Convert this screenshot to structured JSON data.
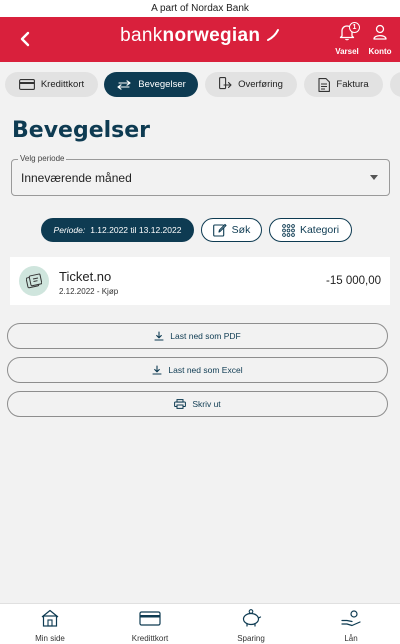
{
  "top_banner": "A part of Nordax Bank",
  "header": {
    "logo_light": "bank",
    "logo_bold": "norwegian",
    "notifications_label": "Varsel",
    "notifications_count": "1",
    "account_label": "Konto"
  },
  "tabs": [
    {
      "label": "Kredittkort",
      "icon": "credit-card-icon"
    },
    {
      "label": "Bevegelser",
      "icon": "transfer-arrows-icon",
      "active": true
    },
    {
      "label": "Overføring",
      "icon": "transfer-icon"
    },
    {
      "label": "Faktura",
      "icon": "invoice-icon"
    }
  ],
  "page_title": "Bevegelser",
  "period_select": {
    "legend": "Velg periode",
    "value": "Inneværende måned"
  },
  "filters": {
    "period_prefix": "Periode:",
    "period_range": "1.12.2022 til 13.12.2022",
    "search_label": "Søk",
    "category_label": "Kategori"
  },
  "transactions": [
    {
      "merchant": "Ticket.no",
      "detail": "2.12.2022 - Kjøp",
      "amount": "-15 000,00",
      "icon": "ticket-icon"
    }
  ],
  "actions": {
    "download_pdf": "Last ned som PDF",
    "download_excel": "Last ned som Excel",
    "print": "Skriv ut"
  },
  "bottom_nav": [
    {
      "label": "Min side",
      "icon": "home-icon"
    },
    {
      "label": "Kredittkort",
      "icon": "credit-card-icon"
    },
    {
      "label": "Sparing",
      "icon": "piggy-bank-icon"
    },
    {
      "label": "Lån",
      "icon": "loan-hand-icon"
    }
  ],
  "colors": {
    "brand_red": "#d9203c",
    "primary_navy": "#0e3b52",
    "background": "#f2f2f2"
  }
}
